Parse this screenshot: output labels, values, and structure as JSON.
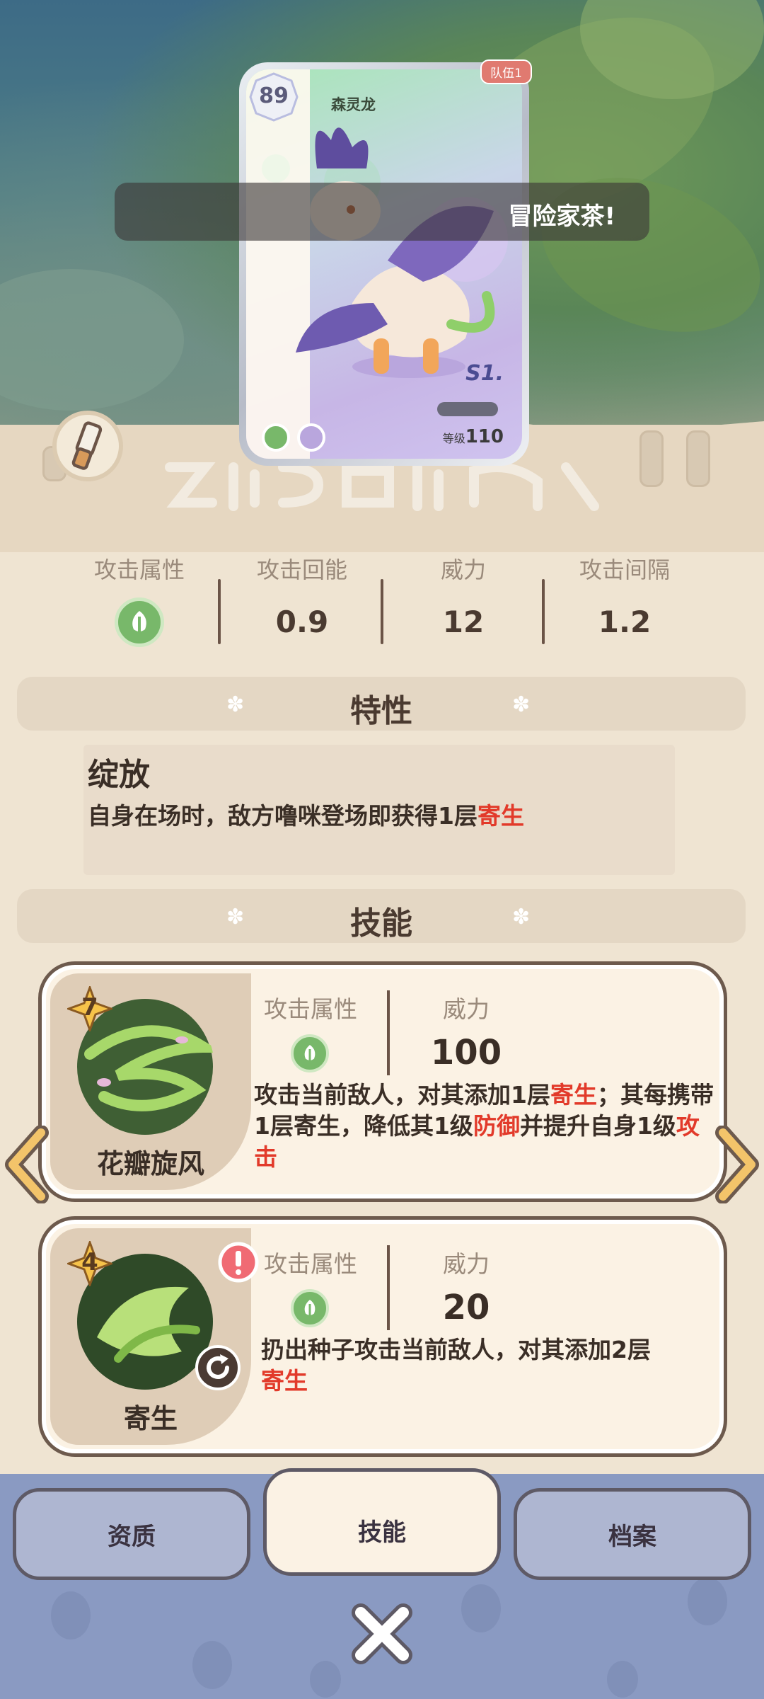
{
  "card": {
    "level": "89",
    "name": "森灵龙",
    "team": "队伍1",
    "series": "S1.",
    "level_label": "等级",
    "level_value": "110"
  },
  "toast": "冒险家茶!",
  "stats": [
    {
      "label": "攻击属性",
      "value": ""
    },
    {
      "label": "攻击回能",
      "value": "0.9"
    },
    {
      "label": "威力",
      "value": "12"
    },
    {
      "label": "攻击间隔",
      "value": "1.2"
    }
  ],
  "sections": {
    "trait": "特性",
    "skill": "技能"
  },
  "trait": {
    "name": "绽放",
    "desc_prefix": "自身在场时，敌方噜咪登场即获得1层",
    "desc_highlight": "寄生"
  },
  "skills": [
    {
      "cost": "7",
      "name": "花瓣旋风",
      "attr_label": "攻击属性",
      "power_label": "威力",
      "power": "100",
      "desc": {
        "p1": "攻击当前敌人，对其添加1层",
        "h1": "寄生",
        "p2": "；其每携带1层寄生，降低其1级",
        "h2": "防御",
        "p3": "并提升自身1级",
        "h3": "攻击"
      }
    },
    {
      "cost": "4",
      "name": "寄生",
      "attr_label": "攻击属性",
      "power_label": "威力",
      "power": "20",
      "desc": {
        "p1": "扔出种子攻击当前敌人，对其添加2层",
        "h1": "寄生"
      }
    }
  ],
  "tabs": [
    {
      "label": "资质"
    },
    {
      "label": "技能"
    },
    {
      "label": "档案"
    }
  ],
  "colors": {
    "grass": "#78b86a",
    "highlight": "#e23a2a",
    "panel": "#efe4d2",
    "bottom_bar": "#8a9ac2"
  }
}
